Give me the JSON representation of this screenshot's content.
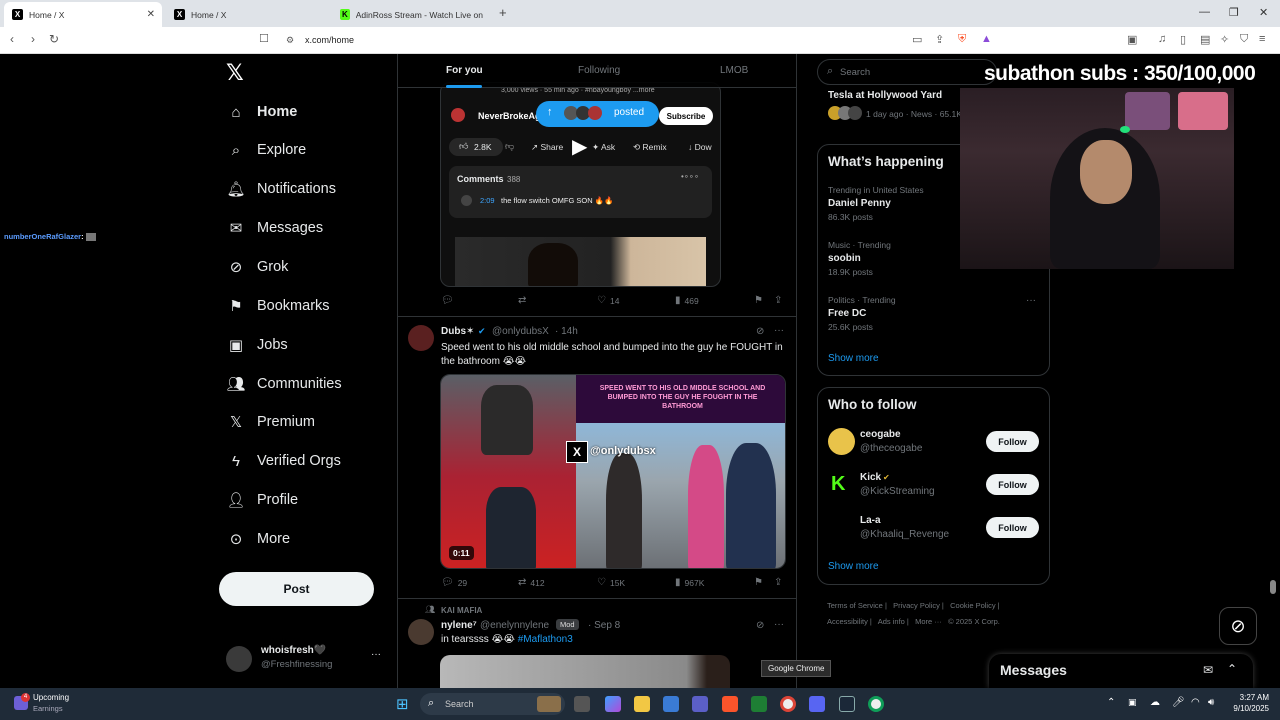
{
  "browser": {
    "tabs": [
      {
        "title": "Home / X"
      },
      {
        "title": "Home / X"
      },
      {
        "title": "AdinRoss Stream - Watch Live on Kick"
      }
    ],
    "url": "x.com/home"
  },
  "overlay": {
    "sub_counter": "subathon subs : 350/100,000",
    "chat_username": "numberOneRafGlazer",
    "chat_sep": ":"
  },
  "sidebar": {
    "items": [
      {
        "label": "Home",
        "icon": "home-icon"
      },
      {
        "label": "Explore",
        "icon": "search-icon"
      },
      {
        "label": "Notifications",
        "icon": "bell-icon"
      },
      {
        "label": "Messages",
        "icon": "envelope-icon"
      },
      {
        "label": "Grok",
        "icon": "grok-icon"
      },
      {
        "label": "Bookmarks",
        "icon": "bookmark-icon"
      },
      {
        "label": "Jobs",
        "icon": "briefcase-icon"
      },
      {
        "label": "Communities",
        "icon": "people-icon"
      },
      {
        "label": "Premium",
        "icon": "x-icon"
      },
      {
        "label": "Verified Orgs",
        "icon": "bolt-icon"
      },
      {
        "label": "Profile",
        "icon": "person-icon"
      },
      {
        "label": "More",
        "icon": "more-circle-icon"
      }
    ],
    "post_label": "Post",
    "account": {
      "name": "whoisfresh🖤",
      "handle": "@Freshfinessing"
    }
  },
  "feed": {
    "tabs": [
      "For you",
      "Following",
      "LMOB"
    ],
    "embed": {
      "meta": "3,000 views · 55 min ago · #nbayoungboy  ...more",
      "channel": "NeverBrokeAg",
      "posted_pill": "posted",
      "subscribe": "Subscribe",
      "likes": "2.8K",
      "share": "Share",
      "ask": "Ask",
      "remix": "Remix",
      "download": "Dow",
      "comments_label": "Comments",
      "comments_count": "388",
      "comment_time": "2:09",
      "comment_text": "the flow switch OMFG SON 🔥🔥"
    },
    "post1_actions": {
      "reply": "",
      "repost": "",
      "like": "14",
      "views": "469"
    },
    "post2": {
      "name": "Dubs✶",
      "handle": "@onlydubsX",
      "time": "· 14h",
      "text": "Speed went to his old middle school and bumped into the guy he FOUGHT in the bathroom 😭😭",
      "image_caption": "SPEED WENT TO HIS OLD MIDDLE SCHOOL AND BUMPED INTO THE GUY HE FOUGHT IN THE BATHROOM",
      "watermark": "@onlydubsx",
      "duration": "0:11",
      "replies": "29",
      "reposts": "412",
      "likes": "15K",
      "views": "967K"
    },
    "post3": {
      "context": "KAI MAFIA",
      "name": "nylene⁷",
      "handle": "@enelynnylene",
      "badge": "Mod",
      "time": "· Sep 8",
      "text": "in tearssss 😭😭",
      "hashtag": "#Maflathon3"
    }
  },
  "right": {
    "search_placeholder": "Search",
    "top_story": {
      "title": "Tesla at Hollywood Yard",
      "meta": "1 day ago · News · 65.1K"
    },
    "whats_happening": "What’s happening",
    "trends": [
      {
        "context": "Trending in United States",
        "name": "Daniel Penny",
        "count": "86.3K posts"
      },
      {
        "context": "Music · Trending",
        "name": "soobin",
        "count": "18.9K posts"
      },
      {
        "context": "Politics · Trending",
        "name": "Free DC",
        "count": "25.6K posts"
      }
    ],
    "show_more": "Show more",
    "who_to_follow": "Who to follow",
    "follow_suggestions": [
      {
        "name": "ceogabe",
        "handle": "@theceogabe"
      },
      {
        "name": "Kick",
        "handle": "@KickStreaming"
      },
      {
        "name": "La-a",
        "handle": "@Khaaliq_Revenge"
      }
    ],
    "follow_label": "Follow",
    "footer": {
      "terms": "Terms of Service",
      "privacy": "Privacy Policy",
      "cookie": "Cookie Policy",
      "accessibility": "Accessibility",
      "ads": "Ads info",
      "more": "More ···",
      "copyright": "© 2025 X Corp."
    },
    "messages_drawer": "Messages"
  },
  "tooltip": "Google Chrome",
  "taskbar": {
    "widget_title": "Upcoming",
    "widget_sub": "Earnings",
    "widget_badge": "4",
    "search": "Search",
    "time": "3:27 AM",
    "date": "9/10/2025"
  },
  "colors": {
    "accent": "#1d9bf0",
    "bg": "#000000",
    "border": "#2f3336",
    "muted": "#71767b"
  }
}
